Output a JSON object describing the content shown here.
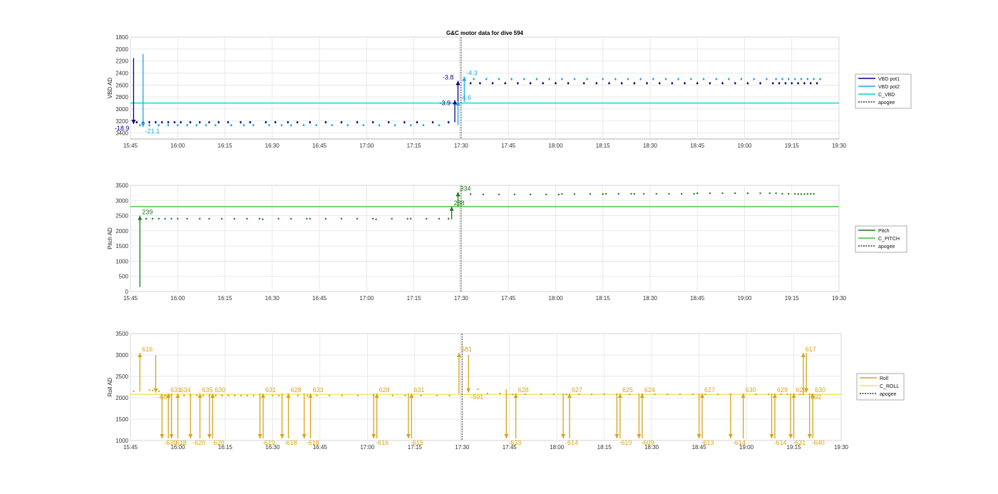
{
  "title": "G&C motor data for dive 594",
  "chart_data": [
    {
      "type": "scatter",
      "ylabel": "VBD AD",
      "y_reversed": true,
      "ylim": [
        1800,
        3500
      ],
      "yticks": [
        1800,
        2000,
        2200,
        2400,
        2600,
        2800,
        3000,
        3200,
        3400
      ],
      "xlim": [
        "15:45",
        "19:30"
      ],
      "xticks": [
        "15:45",
        "16:00",
        "16:15",
        "16:30",
        "16:45",
        "17:00",
        "17:15",
        "17:30",
        "17:45",
        "18:00",
        "18:15",
        "18:30",
        "18:45",
        "19:00",
        "19:15",
        "19:30"
      ],
      "grid": true,
      "legend_position": "outside-right",
      "legend": [
        "VBD pot1",
        "VBD pot2",
        "C_VBD",
        "apogee"
      ],
      "colors": {
        "pot1": "#00008b",
        "pot2": "#1ea7e8",
        "c_line": "#00d4d4",
        "apogee": "#555555"
      },
      "series": [
        {
          "name": "VBD pot1",
          "x": [
            "15:47",
            "15:49",
            "15:51",
            "15:53",
            "15:55",
            "15:57",
            "15:59",
            "16:01",
            "16:04",
            "16:07",
            "16:10",
            "16:13",
            "16:16",
            "16:20",
            "16:23",
            "16:28",
            "16:31",
            "16:35",
            "16:38",
            "16:42",
            "16:47",
            "16:52",
            "16:57",
            "17:02",
            "17:07",
            "17:12",
            "17:16",
            "17:21",
            "17:26",
            "17:33",
            "17:36",
            "17:40",
            "17:44",
            "17:48",
            "17:52",
            "17:56",
            "18:00",
            "18:04",
            "18:09",
            "18:13",
            "18:17",
            "18:21",
            "18:25",
            "18:29",
            "18:33",
            "18:37",
            "18:41",
            "18:45",
            "18:49",
            "18:53",
            "18:57",
            "19:01",
            "19:05",
            "19:09",
            "19:11",
            "19:13",
            "19:15",
            "19:17",
            "19:19",
            "19:21",
            "19:23"
          ],
          "y": [
            3220,
            3220,
            3220,
            3220,
            3220,
            3220,
            3220,
            3220,
            3220,
            3220,
            3220,
            3220,
            3220,
            3220,
            3220,
            3220,
            3220,
            3220,
            3220,
            3220,
            3220,
            3220,
            3220,
            3220,
            3220,
            3220,
            3220,
            3220,
            3220,
            2570,
            2570,
            2570,
            2570,
            2570,
            2570,
            2570,
            2570,
            2570,
            2570,
            2570,
            2570,
            2570,
            2570,
            2570,
            2570,
            2570,
            2570,
            2570,
            2570,
            2570,
            2570,
            2570,
            2570,
            2570,
            2570,
            2570,
            2570,
            2570,
            2570,
            2570,
            2570
          ]
        },
        {
          "name": "VBD pot2",
          "x": [
            "15:48",
            "15:51",
            "15:54",
            "15:57",
            "16:00",
            "16:03",
            "16:06",
            "16:09",
            "16:12",
            "16:17",
            "16:21",
            "16:24",
            "16:29",
            "16:33",
            "16:36",
            "16:40",
            "16:44",
            "16:49",
            "16:54",
            "16:59",
            "17:04",
            "17:09",
            "17:14",
            "17:18",
            "17:23",
            "17:34",
            "17:38",
            "17:42",
            "17:46",
            "17:50",
            "17:54",
            "17:58",
            "18:02",
            "18:06",
            "18:10",
            "18:15",
            "18:19",
            "18:23",
            "18:27",
            "18:31",
            "18:35",
            "18:39",
            "18:43",
            "18:47",
            "18:51",
            "18:55",
            "18:59",
            "19:03",
            "19:07",
            "19:10",
            "19:12",
            "19:14",
            "19:16",
            "19:18",
            "19:20",
            "19:22",
            "19:24"
          ],
          "y": [
            3270,
            3270,
            3270,
            3270,
            3270,
            3270,
            3270,
            3270,
            3270,
            3270,
            3270,
            3270,
            3270,
            3270,
            3270,
            3270,
            3270,
            3270,
            3270,
            3270,
            3270,
            3270,
            3270,
            3270,
            3270,
            2500,
            2500,
            2500,
            2500,
            2500,
            2500,
            2500,
            2500,
            2500,
            2500,
            2500,
            2500,
            2500,
            2500,
            2500,
            2500,
            2500,
            2500,
            2500,
            2500,
            2500,
            2500,
            2500,
            2500,
            2500,
            2500,
            2500,
            2500,
            2500,
            2500,
            2500,
            2500
          ]
        }
      ],
      "reference_line": {
        "name": "C_VBD",
        "y": 2900
      },
      "apogee": "17:30",
      "arrows": [
        {
          "series": "pot1",
          "x": "15:46",
          "y_from": 2150,
          "y_to": 3250,
          "label": "-18.9"
        },
        {
          "series": "pot2",
          "x": "15:49",
          "y_from": 2080,
          "y_to": 3300,
          "label": "-21.1"
        },
        {
          "series": "pot1",
          "x": "17:28",
          "y_from": 3220,
          "y_to": 2850,
          "label": "-3.9"
        },
        {
          "series": "pot1",
          "x": "17:29",
          "y_from": 2900,
          "y_to": 2530,
          "label": "-3.8"
        },
        {
          "series": "pot2",
          "x": "17:29",
          "y_from": 3270,
          "y_to": 2870,
          "label": "-4.6"
        },
        {
          "series": "pot2",
          "x": "17:31",
          "y_from": 2880,
          "y_to": 2460,
          "label": "-4.3"
        }
      ]
    },
    {
      "type": "scatter",
      "ylabel": "Pitch AD",
      "ylim": [
        0,
        3500
      ],
      "yticks": [
        0,
        500,
        1000,
        1500,
        2000,
        2500,
        3000,
        3500
      ],
      "xlim": [
        "15:45",
        "19:30"
      ],
      "xticks": [
        "15:45",
        "16:00",
        "16:15",
        "16:30",
        "16:45",
        "17:00",
        "17:15",
        "17:30",
        "17:45",
        "18:00",
        "18:15",
        "18:30",
        "18:45",
        "19:00",
        "19:15",
        "19:30"
      ],
      "grid": true,
      "legend_position": "outside-right",
      "legend": [
        "Pitch",
        "C_PITCH",
        "apogee"
      ],
      "colors": {
        "pitch": "#1a7a1a",
        "c_line": "#3cc43c",
        "apogee": "#555555"
      },
      "series": [
        {
          "name": "Pitch",
          "x": [
            "15:48",
            "15:50",
            "15:52",
            "15:54",
            "15:56",
            "15:58",
            "16:00",
            "16:03",
            "16:07",
            "16:10",
            "16:14",
            "16:18",
            "16:22",
            "16:26",
            "16:27",
            "16:32",
            "16:36",
            "16:41",
            "16:42",
            "16:47",
            "16:52",
            "16:57",
            "17:02",
            "17:03",
            "17:08",
            "17:13",
            "17:14",
            "17:19",
            "17:23",
            "17:26",
            "17:33",
            "17:37",
            "17:42",
            "17:47",
            "17:52",
            "17:57",
            "18:01",
            "18:02",
            "18:06",
            "18:11",
            "18:15",
            "18:16",
            "18:20",
            "18:24",
            "18:25",
            "18:28",
            "18:32",
            "18:36",
            "18:40",
            "18:44",
            "18:45",
            "18:49",
            "18:53",
            "18:57",
            "19:01",
            "19:05",
            "19:08",
            "19:10",
            "19:12",
            "19:14",
            "19:16",
            "19:17",
            "19:18",
            "19:19",
            "19:20",
            "19:21",
            "19:22"
          ],
          "y": [
            2400,
            2400,
            2400,
            2400,
            2400,
            2400,
            2400,
            2400,
            2400,
            2400,
            2400,
            2400,
            2400,
            2400,
            2380,
            2400,
            2400,
            2400,
            2400,
            2400,
            2400,
            2400,
            2400,
            2380,
            2400,
            2400,
            2400,
            2400,
            2400,
            2400,
            3210,
            3200,
            3200,
            3200,
            3200,
            3200,
            3200,
            3220,
            3210,
            3210,
            3210,
            3220,
            3220,
            3220,
            3220,
            3220,
            3220,
            3220,
            3220,
            3220,
            3240,
            3240,
            3240,
            3240,
            3240,
            3240,
            3240,
            3240,
            3220,
            3220,
            3220,
            3210,
            3210,
            3210,
            3220,
            3220,
            3220
          ]
        }
      ],
      "reference_line": {
        "name": "C_PITCH",
        "y": 2800
      },
      "apogee": "17:30",
      "arrows": [
        {
          "x": "15:48",
          "y_from": 150,
          "y_to": 2500,
          "label": "239"
        },
        {
          "x": "17:27",
          "y_from": 2380,
          "y_to": 2800,
          "label": "288"
        },
        {
          "x": "17:29",
          "y_from": 2800,
          "y_to": 3280,
          "label": "334"
        }
      ]
    },
    {
      "type": "scatter",
      "ylabel": "Roll AD",
      "ylim": [
        1000,
        3500
      ],
      "yticks": [
        1000,
        1500,
        2000,
        2500,
        3000,
        3500
      ],
      "xlim": [
        "15:45",
        "19:30"
      ],
      "xticks": [
        "15:45",
        "16:00",
        "16:15",
        "16:30",
        "16:45",
        "17:00",
        "17:15",
        "17:30",
        "17:45",
        "18:00",
        "18:15",
        "18:30",
        "18:45",
        "19:00",
        "19:15",
        "19:30"
      ],
      "grid": true,
      "legend_position": "outside-right",
      "legend": [
        "Roll",
        "C_ROLL",
        "apogee"
      ],
      "colors": {
        "roll": "#d9a21b",
        "c_line": "#f2e35a",
        "apogee": "#555555"
      },
      "series": [
        {
          "name": "Roll",
          "x": [
            "15:46",
            "15:51",
            "15:52",
            "15:53",
            "15:54",
            "15:56",
            "15:57",
            "15:58",
            "16:00",
            "16:02",
            "16:04",
            "16:06",
            "16:08",
            "16:10",
            "16:12",
            "16:14",
            "16:16",
            "16:18",
            "16:20",
            "16:22",
            "16:24",
            "16:27",
            "16:30",
            "16:32",
            "16:35",
            "16:38",
            "16:41",
            "16:44",
            "16:48",
            "16:52",
            "16:57",
            "17:02",
            "17:08",
            "17:12",
            "17:17",
            "17:22",
            "17:26",
            "17:32",
            "17:35",
            "17:38",
            "17:42",
            "17:46",
            "17:50",
            "17:55",
            "17:59",
            "18:03",
            "18:07",
            "18:11",
            "18:15",
            "18:19",
            "18:23",
            "18:27",
            "18:31",
            "18:35",
            "18:39",
            "18:43",
            "18:47",
            "18:51",
            "18:55",
            "18:59",
            "19:03",
            "19:07",
            "19:11",
            "19:13",
            "19:15",
            "19:17",
            "19:18",
            "19:20",
            "19:21"
          ],
          "y": [
            2150,
            2180,
            2170,
            2160,
            2150,
            2060,
            2060,
            2060,
            2050,
            2050,
            2050,
            2050,
            2050,
            2050,
            2050,
            2050,
            2050,
            2050,
            2050,
            2050,
            2050,
            2050,
            2050,
            2050,
            2050,
            2050,
            2050,
            2050,
            2050,
            2050,
            2050,
            2050,
            2050,
            2050,
            2050,
            2050,
            2050,
            2160,
            2200,
            2100,
            2100,
            2080,
            2080,
            2080,
            2080,
            2080,
            2080,
            2080,
            2080,
            2080,
            2080,
            2080,
            2080,
            2080,
            2080,
            2080,
            2080,
            2080,
            2080,
            2080,
            2080,
            2080,
            2080,
            2080,
            2080,
            2080,
            2080,
            2080,
            2080
          ]
        }
      ],
      "reference_line": {
        "name": "C_ROLL",
        "y": 2080
      },
      "apogee": "17:30",
      "arrows": [
        {
          "x": "15:48",
          "y_from": 2150,
          "y_to": 3050,
          "label": "616"
        },
        {
          "x": "15:53",
          "y_from": 3000,
          "y_to": 2120,
          "label": "-607"
        },
        {
          "x": "15:55",
          "y_from": 2100,
          "y_to": 1050,
          "label": "-639"
        },
        {
          "x": "15:57",
          "y_from": 1050,
          "y_to": 2100,
          "label": "631"
        },
        {
          "x": "15:58",
          "y_from": 2100,
          "y_to": 1050,
          "label": "-618"
        },
        {
          "x": "16:00",
          "y_from": 1050,
          "y_to": 2100,
          "label": "634"
        },
        {
          "x": "16:04",
          "y_from": 2100,
          "y_to": 1050,
          "label": "-620"
        },
        {
          "x": "16:07",
          "y_from": 1050,
          "y_to": 2100,
          "label": "635"
        },
        {
          "x": "16:10",
          "y_from": 2100,
          "y_to": 1050,
          "label": "-620"
        },
        {
          "x": "16:11",
          "y_from": 1050,
          "y_to": 2100,
          "label": "630"
        },
        {
          "x": "16:26",
          "y_from": 2100,
          "y_to": 1050,
          "label": "-619"
        },
        {
          "x": "16:27",
          "y_from": 1050,
          "y_to": 2100,
          "label": "631"
        },
        {
          "x": "16:33",
          "y_from": 2100,
          "y_to": 1050,
          "label": "-618"
        },
        {
          "x": "16:35",
          "y_from": 1050,
          "y_to": 2100,
          "label": "628"
        },
        {
          "x": "16:40",
          "y_from": 2100,
          "y_to": 1050,
          "label": "-618"
        },
        {
          "x": "16:42",
          "y_from": 1050,
          "y_to": 2100,
          "label": "633"
        },
        {
          "x": "17:02",
          "y_from": 2100,
          "y_to": 1050,
          "label": "-616"
        },
        {
          "x": "17:03",
          "y_from": 1050,
          "y_to": 2100,
          "label": "628"
        },
        {
          "x": "17:13",
          "y_from": 2100,
          "y_to": 1050,
          "label": "-615"
        },
        {
          "x": "17:14",
          "y_from": 1050,
          "y_to": 2100,
          "label": "631"
        },
        {
          "x": "17:29",
          "y_from": 2100,
          "y_to": 3050,
          "label": "581"
        },
        {
          "x": "17:32",
          "y_from": 3000,
          "y_to": 2120,
          "label": "-591"
        },
        {
          "x": "17:44",
          "y_from": 2200,
          "y_to": 1050,
          "label": "-633"
        },
        {
          "x": "17:47",
          "y_from": 1050,
          "y_to": 2100,
          "label": "628"
        },
        {
          "x": "18:02",
          "y_from": 2100,
          "y_to": 1050,
          "label": "-614"
        },
        {
          "x": "18:04",
          "y_from": 1050,
          "y_to": 2100,
          "label": "627"
        },
        {
          "x": "18:19",
          "y_from": 2100,
          "y_to": 1050,
          "label": "-610"
        },
        {
          "x": "18:20",
          "y_from": 1050,
          "y_to": 2100,
          "label": "625"
        },
        {
          "x": "18:26",
          "y_from": 2100,
          "y_to": 1050,
          "label": "-609"
        },
        {
          "x": "18:27",
          "y_from": 1050,
          "y_to": 2100,
          "label": "624"
        },
        {
          "x": "18:45",
          "y_from": 2100,
          "y_to": 1050,
          "label": "-613"
        },
        {
          "x": "18:46",
          "y_from": 1050,
          "y_to": 2100,
          "label": "627"
        },
        {
          "x": "18:55",
          "y_from": 2100,
          "y_to": 1050,
          "label": "-614"
        },
        {
          "x": "18:59",
          "y_from": 1050,
          "y_to": 2100,
          "label": "630"
        },
        {
          "x": "19:08",
          "y_from": 2100,
          "y_to": 1050,
          "label": "-614"
        },
        {
          "x": "19:09",
          "y_from": 1050,
          "y_to": 2100,
          "label": "629"
        },
        {
          "x": "19:14",
          "y_from": 2100,
          "y_to": 1050,
          "label": "-631"
        },
        {
          "x": "19:15",
          "y_from": 1050,
          "y_to": 2100,
          "label": "629"
        },
        {
          "x": "19:18",
          "y_from": 2100,
          "y_to": 3050,
          "label": "617"
        },
        {
          "x": "19:19",
          "y_from": 3050,
          "y_to": 2120,
          "label": "-592"
        },
        {
          "x": "19:20",
          "y_from": 2100,
          "y_to": 1050,
          "label": "-640"
        },
        {
          "x": "19:21",
          "y_from": 1050,
          "y_to": 2100,
          "label": "630"
        }
      ]
    }
  ]
}
